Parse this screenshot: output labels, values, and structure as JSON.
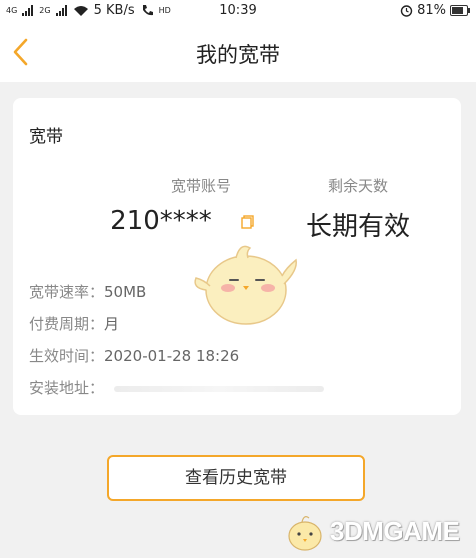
{
  "status_bar": {
    "signal_left": "4G",
    "signal_right": "2G",
    "speed": "5 KB/s",
    "hd": "HD",
    "time": "10:39",
    "battery": "81%",
    "battery_level": 0.81
  },
  "nav": {
    "title": "我的宽带",
    "accent": "#f4a72a"
  },
  "card": {
    "title": "宽带",
    "account_label": "宽带账号",
    "account_value": "210****",
    "days_label": "剩余天数",
    "days_value": "长期有效",
    "rows": [
      {
        "label": "宽带速率：",
        "value": "50MB"
      },
      {
        "label": "付费周期：",
        "value": "月"
      },
      {
        "label": "生效时间：",
        "value": "2020-01-28 18:26"
      },
      {
        "label": "安装地址：",
        "value": ""
      }
    ]
  },
  "history_button": {
    "label": "查看历史宽带"
  },
  "watermark": {
    "text": "3DMGAME"
  }
}
